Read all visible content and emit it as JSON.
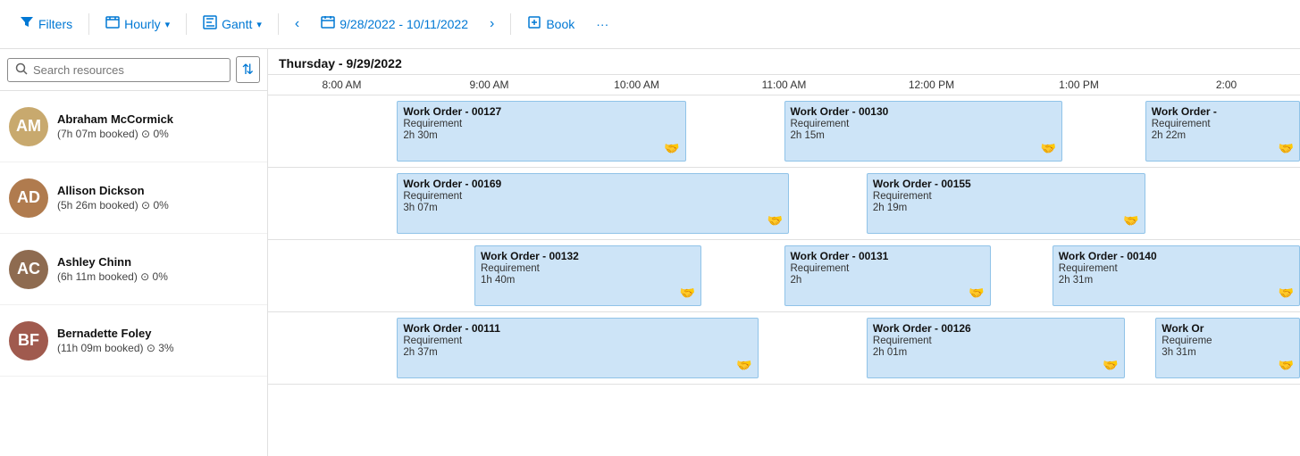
{
  "toolbar": {
    "filters_label": "Filters",
    "hourly_label": "Hourly",
    "gantt_label": "Gantt",
    "date_range": "9/28/2022 - 10/11/2022",
    "book_label": "Book"
  },
  "search": {
    "placeholder": "Search resources"
  },
  "gantt": {
    "date_header": "Thursday - 9/29/2022",
    "hours": [
      "8:00 AM",
      "9:00 AM",
      "10:00 AM",
      "11:00 AM",
      "12:00 PM",
      "1:00 PM",
      "2:00"
    ]
  },
  "resources": [
    {
      "id": "abraham",
      "name": "Abraham McCormick",
      "meta": "(7h 07m booked) ⊙ 0%",
      "initials": "AM",
      "avatar_class": "avatar-am",
      "orders": [
        {
          "id": "wo-00127",
          "title": "Work Order - 00127",
          "type": "Requirement",
          "duration": "2h 30m",
          "left_pct": 12.5,
          "width_pct": 28
        },
        {
          "id": "wo-00130",
          "title": "Work Order - 00130",
          "type": "Requirement",
          "duration": "2h 15m",
          "left_pct": 50,
          "width_pct": 27
        },
        {
          "id": "wo-00130b",
          "title": "Work Order -",
          "type": "Requirement",
          "duration": "2h 22m",
          "left_pct": 85,
          "width_pct": 15
        }
      ]
    },
    {
      "id": "allison",
      "name": "Allison Dickson",
      "meta": "(5h 26m booked) ⊙ 0%",
      "initials": "AD",
      "avatar_class": "avatar-ad",
      "orders": [
        {
          "id": "wo-00169",
          "title": "Work Order - 00169",
          "type": "Requirement",
          "duration": "3h 07m",
          "left_pct": 12.5,
          "width_pct": 38
        },
        {
          "id": "wo-00155",
          "title": "Work Order - 00155",
          "type": "Requirement",
          "duration": "2h 19m",
          "left_pct": 58,
          "width_pct": 27
        }
      ]
    },
    {
      "id": "ashley",
      "name": "Ashley Chinn",
      "meta": "(6h 11m booked) ⊙ 0%",
      "initials": "AC",
      "avatar_class": "avatar-ac",
      "orders": [
        {
          "id": "wo-00132",
          "title": "Work Order - 00132",
          "type": "Requirement",
          "duration": "1h 40m",
          "left_pct": 20,
          "width_pct": 22
        },
        {
          "id": "wo-00131",
          "title": "Work Order - 00131",
          "type": "Requirement",
          "duration": "2h",
          "left_pct": 50,
          "width_pct": 20
        },
        {
          "id": "wo-00140",
          "title": "Work Order - 00140",
          "type": "Requirement",
          "duration": "2h 31m",
          "left_pct": 76,
          "width_pct": 24
        }
      ]
    },
    {
      "id": "bernadette",
      "name": "Bernadette Foley",
      "meta": "(11h 09m booked) ⊙ 3%",
      "initials": "BF",
      "avatar_class": "avatar-bf",
      "orders": [
        {
          "id": "wo-00111",
          "title": "Work Order - 00111",
          "type": "Requirement",
          "duration": "2h 37m",
          "left_pct": 12.5,
          "width_pct": 35
        },
        {
          "id": "wo-00126",
          "title": "Work Order - 00126",
          "type": "Requirement",
          "duration": "2h 01m",
          "left_pct": 58,
          "width_pct": 25
        },
        {
          "id": "wo-00126b",
          "title": "Work Or",
          "type": "Requireme",
          "duration": "3h 31m",
          "left_pct": 86,
          "width_pct": 14
        }
      ]
    }
  ]
}
